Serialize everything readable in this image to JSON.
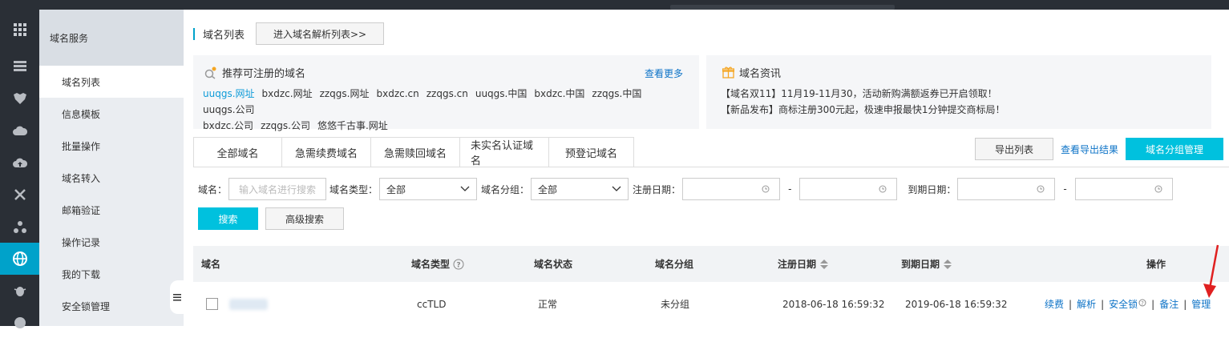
{
  "sidebar": {
    "service_title": "域名服务",
    "items": [
      {
        "label": "域名列表",
        "active": true
      },
      {
        "label": "信息模板"
      },
      {
        "label": "批量操作"
      },
      {
        "label": "域名转入"
      },
      {
        "label": "邮箱验证"
      },
      {
        "label": "操作记录"
      },
      {
        "label": "我的下载"
      },
      {
        "label": "安全锁管理"
      }
    ],
    "rail_icons": [
      "grid-icon",
      "server-icon",
      "shield-icon",
      "cloud-icon",
      "cloud-upload-icon",
      "network-icon",
      "cluster-icon",
      "globe-icon",
      "bug-icon",
      "circle-icon"
    ]
  },
  "header": {
    "title": "域名列表",
    "parse_list_button": "进入域名解析列表>>"
  },
  "recommend": {
    "title": "推荐可注册的域名",
    "more": "查看更多",
    "domains": [
      "uuqgs.网址",
      "bxdzc.网址",
      "zzqgs.网址",
      "bxdzc.cn",
      "zzqgs.cn",
      "uuqgs.中国",
      "bxdzc.中国",
      "zzqgs.中国",
      "uuqgs.公司",
      "bxdzc.公司",
      "zzqgs.公司",
      "悠悠千古事.网址"
    ]
  },
  "news": {
    "title": "域名资讯",
    "items": [
      "【域名双11】11月19-11月30，活动新购满额返券已开启领取！",
      "【新品发布】商标注册300元起，极速申报最快1分钟提交商标局！"
    ]
  },
  "tabs": [
    "全部域名",
    "急需续费域名",
    "急需赎回域名",
    "未实名认证域名",
    "预登记域名"
  ],
  "toolbar": {
    "export": "导出列表",
    "view_export": "查看导出结果",
    "group_manage": "域名分组管理"
  },
  "filter": {
    "domain_label": "域名：",
    "domain_placeholder": "输入域名进行搜索",
    "type_label": "域名类型：",
    "type_value": "全部",
    "group_label": "域名分组：",
    "group_value": "全部",
    "reg_label": "注册日期：",
    "expire_label": "到期日期：",
    "dash": "-",
    "search": "搜索",
    "advanced": "高级搜索"
  },
  "table": {
    "columns": [
      "域名",
      "域名类型",
      "域名状态",
      "域名分组",
      "注册日期",
      "到期日期",
      "操作"
    ],
    "rows": [
      {
        "domain": "",
        "type": "ccTLD",
        "status": "正常",
        "group": "未分组",
        "reg_date": "2018-06-18 16:59:32",
        "expire_date": "2019-06-18 16:59:32",
        "ops": [
          "续费",
          "解析",
          "安全锁",
          "备注",
          "管理"
        ]
      }
    ]
  },
  "colors": {
    "accent": "#00c1de",
    "link": "#0d73c7",
    "arrow": "#e02020"
  }
}
